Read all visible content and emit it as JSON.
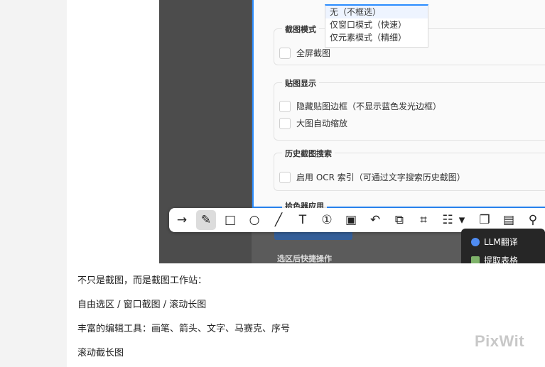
{
  "screenshot": {
    "dropdown_options": [
      "无（不框选）",
      "仅窗口模式（快速）",
      "仅元素模式（精细）"
    ],
    "groups": [
      {
        "title": "截图模式",
        "options": [
          "全屏截图"
        ]
      },
      {
        "title": "贴图显示",
        "options": [
          "隐藏贴图边框（不显示蓝色发光边框）",
          "大图自动缩放"
        ]
      },
      {
        "title": "历史截图搜索",
        "options": [
          "启用 OCR 索引（可通过文字搜索历史截图）"
        ]
      }
    ],
    "cut_group_title": "拾色器应用",
    "lower_section_title": "选区后快捷操作",
    "menu_items": [
      "LLM翻译",
      "提取表格"
    ],
    "toolbar_tools": [
      "arrow-icon",
      "pen-icon",
      "rectangle-icon",
      "ellipse-icon",
      "line-icon",
      "text-icon",
      "number-icon",
      "mosaic-icon",
      "undo-icon",
      "translate-icon",
      "ocr-icon",
      "ai-icon",
      "dropdown-arrow-icon",
      "copy-icon",
      "save-icon",
      "pin-icon"
    ],
    "toolbar_glyphs": [
      "→",
      "✎",
      "□",
      "○",
      "╱",
      "T",
      "①",
      "▣",
      "↶",
      "⧉",
      "⌗",
      "☷",
      "▾",
      "❐",
      "▤",
      "⚲"
    ],
    "accent_color": "#2b8cff"
  },
  "article": {
    "lines": [
      "不只是截图，而是截图工作站：",
      "自由选区 / 窗口截图 / 滚动长图",
      "丰富的编辑工具：画笔、箭头、文字、马赛克、序号",
      "滚动截长图"
    ]
  },
  "watermark": "PixWit"
}
